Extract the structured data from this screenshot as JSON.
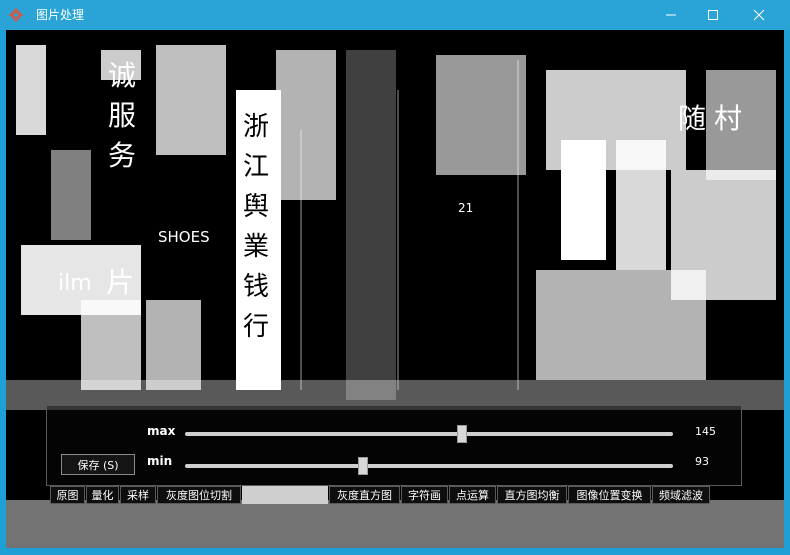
{
  "window": {
    "title": "图片处理"
  },
  "controls": {
    "save_label": "保存 (S)",
    "max": {
      "label": "max",
      "value": 145,
      "min_value": 0,
      "max_value": 255
    },
    "min": {
      "label": "min",
      "value": 93,
      "min_value": 0,
      "max_value": 255
    }
  },
  "tabs": [
    {
      "label": "原图"
    },
    {
      "label": "量化"
    },
    {
      "label": "采样"
    },
    {
      "label": "灰度图位切割"
    },
    {
      "label": ""
    },
    {
      "label": "灰度直方图"
    },
    {
      "label": "字符画"
    },
    {
      "label": "点运算"
    },
    {
      "label": "直方图均衡"
    },
    {
      "label": "图像位置变换"
    },
    {
      "label": "频域滤波"
    }
  ],
  "image": {
    "signs": [
      "诚",
      "服",
      "务",
      "浙",
      "江",
      "舆",
      "業",
      "钱",
      "行",
      "随",
      "村",
      "SHOES",
      "ilm",
      "片",
      "21"
    ]
  }
}
